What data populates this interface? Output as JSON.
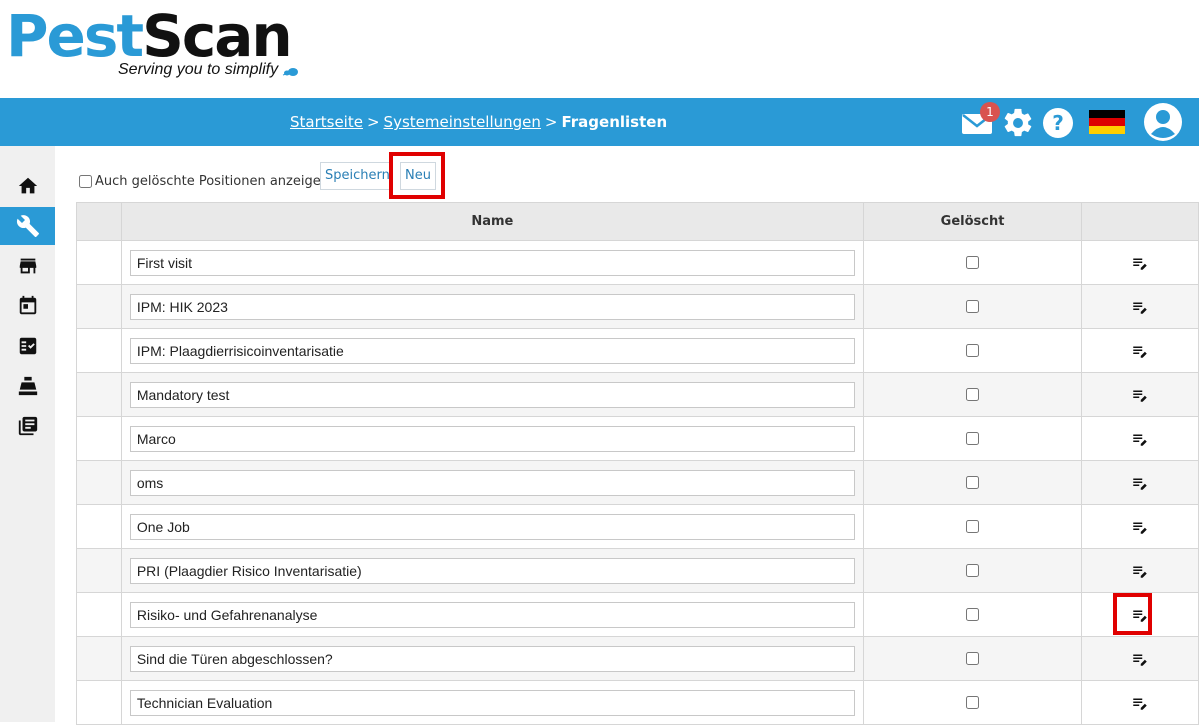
{
  "brand": {
    "pest": "Pest",
    "scan": "Scan",
    "tagline": "Serving you to simplify"
  },
  "breadcrumb": {
    "home": "Startseite",
    "separator": ">",
    "settings": "Systemeinstellungen",
    "current": "Fragenlisten"
  },
  "header": {
    "mail_badge": "1",
    "icons": [
      "mail-icon",
      "gear-icon",
      "help-icon",
      "german-flag-icon",
      "user-avatar-icon"
    ]
  },
  "sidebar": {
    "items": [
      {
        "icon": "home-icon",
        "active": false
      },
      {
        "icon": "wrench-icon",
        "active": true
      },
      {
        "icon": "store-icon",
        "active": false
      },
      {
        "icon": "calendar-icon",
        "active": false
      },
      {
        "icon": "checklist-icon",
        "active": false
      },
      {
        "icon": "cash-register-icon",
        "active": false
      },
      {
        "icon": "library-icon",
        "active": false
      }
    ]
  },
  "toolbar": {
    "show_deleted_label": "Auch gelöschte Positionen anzeigen",
    "save_label": "Speichern",
    "new_label": "Neu"
  },
  "table": {
    "headers": {
      "name": "Name",
      "deleted": "Gelöscht"
    },
    "rows": [
      {
        "name": "First visit"
      },
      {
        "name": "IPM: HIK 2023"
      },
      {
        "name": "IPM: Plaagdierrisicoinventarisatie"
      },
      {
        "name": "Mandatory test"
      },
      {
        "name": "Marco"
      },
      {
        "name": "oms"
      },
      {
        "name": "One Job"
      },
      {
        "name": "PRI (Plaagdier Risico Inventarisatie)"
      },
      {
        "name": "Risiko- und Gefahrenanalyse"
      },
      {
        "name": "Sind die Türen abgeschlossen?"
      },
      {
        "name": "Technician Evaluation"
      }
    ]
  },
  "colors": {
    "accent": "#2a9ad6",
    "highlight": "#e00000",
    "badge": "#d9534f"
  }
}
